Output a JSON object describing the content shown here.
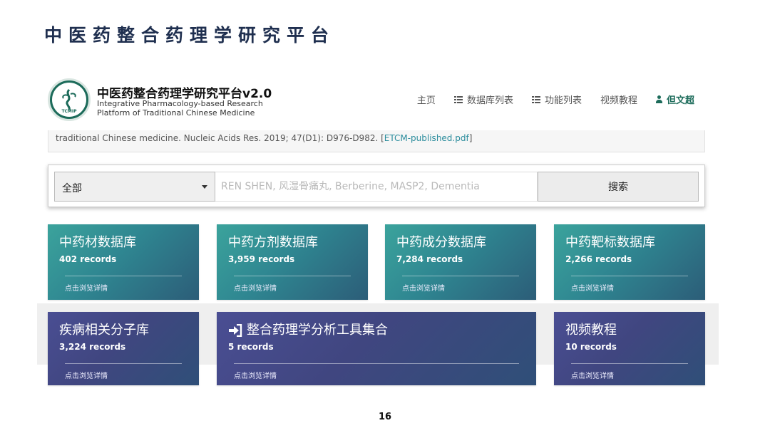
{
  "slide": {
    "title": "中医药整合药理学研究平台",
    "page_number": "16"
  },
  "header": {
    "brand_title": "中医药整合药理学研究平台v2.0",
    "brand_sub_line1": "Integrative Pharmacology-based Research",
    "brand_sub_line2": "Platform of Traditional Chinese Medicine",
    "logo_text": "TCMIP",
    "nav": [
      {
        "label": "主页"
      },
      {
        "label": "数据库列表",
        "icon": "list-icon"
      },
      {
        "label": "功能列表",
        "icon": "list-icon"
      },
      {
        "label": "视频教程"
      },
      {
        "label": "但文超",
        "icon": "user-icon"
      }
    ]
  },
  "citation": {
    "text": "traditional Chinese medicine. Nucleic Acids Res. 2019; 47(D1): D976-D982. [",
    "link": "ETCM-published.pdf",
    "suffix": "]"
  },
  "search": {
    "selected": "全部",
    "placeholder": "REN SHEN, 风湿骨痛丸, Berberine, MASP2, Dementia",
    "button": "搜索"
  },
  "cards_row1": [
    {
      "title": "中药材数据库",
      "records": "402 records",
      "detail": "点击浏览详情"
    },
    {
      "title": "中药方剂数据库",
      "records": "3,959 records",
      "detail": "点击浏览详情"
    },
    {
      "title": "中药成分数据库",
      "records": "7,284 records",
      "detail": "点击浏览详情"
    },
    {
      "title": "中药靶标数据库",
      "records": "2,266 records",
      "detail": "点击浏览详情"
    }
  ],
  "cards_row2": [
    {
      "title": "疾病相关分子库",
      "records": "3,224 records",
      "detail": "点击浏览详情"
    },
    {
      "title": "整合药理学分析工具集合",
      "records": "5 records",
      "detail": "点击浏览详情",
      "icon": "sign-in-icon"
    },
    {
      "title": "视频教程",
      "records": "10 records",
      "detail": "点击浏览详情"
    }
  ],
  "colors": {
    "teal": "#2f8691",
    "purple": "#404680",
    "brand_green": "#1c6b5a",
    "link": "#2a8c9c"
  }
}
